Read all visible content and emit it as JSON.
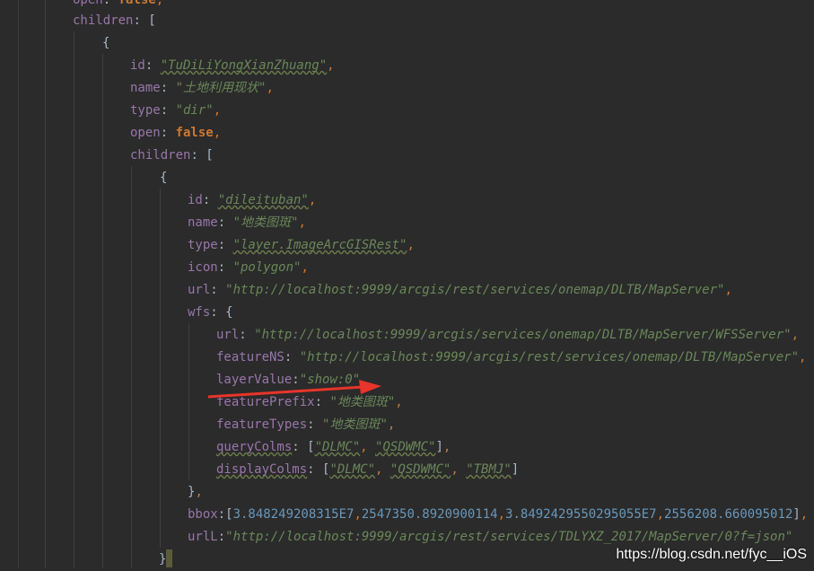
{
  "lines": [
    {
      "name": "line-open",
      "parts": [
        [
          "key",
          "open"
        ],
        [
          "plain",
          ": "
        ],
        [
          "kw",
          "false"
        ],
        [
          "punct",
          ","
        ]
      ]
    },
    {
      "name": "line-children-1",
      "parts": [
        [
          "key",
          "children"
        ],
        [
          "plain",
          ": ["
        ]
      ]
    },
    {
      "name": "line-brace-1",
      "parts": [
        [
          "plain",
          "{"
        ]
      ]
    },
    {
      "name": "line-id-1",
      "parts": [
        [
          "key",
          "id"
        ],
        [
          "plain",
          ": "
        ],
        [
          "str",
          "\"TuDiLiYongXianZhuang\""
        ],
        [
          "punct",
          ","
        ]
      ]
    },
    {
      "name": "line-name-1",
      "parts": [
        [
          "key",
          "name"
        ],
        [
          "plain",
          ": "
        ],
        [
          "str",
          "\"土地利用现状\""
        ],
        [
          "punct",
          ","
        ]
      ]
    },
    {
      "name": "line-type-1",
      "parts": [
        [
          "key",
          "type"
        ],
        [
          "plain",
          ": "
        ],
        [
          "str",
          "\"dir\""
        ],
        [
          "punct",
          ","
        ]
      ]
    },
    {
      "name": "line-open-2",
      "parts": [
        [
          "key",
          "open"
        ],
        [
          "plain",
          ": "
        ],
        [
          "kw",
          "false"
        ],
        [
          "punct",
          ","
        ]
      ]
    },
    {
      "name": "line-children-2",
      "parts": [
        [
          "key",
          "children"
        ],
        [
          "plain",
          ": ["
        ]
      ]
    },
    {
      "name": "line-brace-2",
      "parts": [
        [
          "plain",
          "{"
        ]
      ]
    },
    {
      "name": "line-id-2",
      "parts": [
        [
          "key",
          "id"
        ],
        [
          "plain",
          ": "
        ],
        [
          "str",
          "\"dileituban\""
        ],
        [
          "punct",
          ","
        ]
      ]
    },
    {
      "name": "line-name-2",
      "parts": [
        [
          "key",
          "name"
        ],
        [
          "plain",
          ": "
        ],
        [
          "str",
          "\"地类图斑\""
        ],
        [
          "punct",
          ","
        ]
      ]
    },
    {
      "name": "line-type-2",
      "parts": [
        [
          "key",
          "type"
        ],
        [
          "plain",
          ": "
        ],
        [
          "str",
          "\"layer.ImageArcGISRest\""
        ],
        [
          "punct",
          ","
        ]
      ]
    },
    {
      "name": "line-icon",
      "parts": [
        [
          "key",
          "icon"
        ],
        [
          "plain",
          ": "
        ],
        [
          "str",
          "\"polygon\""
        ],
        [
          "punct",
          ","
        ]
      ]
    },
    {
      "name": "line-url",
      "parts": [
        [
          "key",
          "url"
        ],
        [
          "plain",
          ": "
        ],
        [
          "str",
          "\"http://localhost:9999/arcgis/rest/services/onemap/DLTB/MapServer\""
        ],
        [
          "punct",
          ","
        ]
      ]
    },
    {
      "name": "line-wfs",
      "parts": [
        [
          "key",
          "wfs"
        ],
        [
          "plain",
          ": {"
        ]
      ]
    },
    {
      "name": "line-wfs-url",
      "parts": [
        [
          "key",
          "url"
        ],
        [
          "plain",
          ": "
        ],
        [
          "str",
          "\"http://localhost:9999/arcgis/services/onemap/DLTB/MapServer/WFSServer\""
        ],
        [
          "punct",
          ","
        ]
      ]
    },
    {
      "name": "line-featurens",
      "parts": [
        [
          "key",
          "featureNS"
        ],
        [
          "plain",
          ": "
        ],
        [
          "str",
          "\"http://localhost:9999/arcgis/rest/services/onemap/DLTB/MapServer\""
        ],
        [
          "punct",
          ","
        ]
      ]
    },
    {
      "name": "line-layervalue",
      "parts": [
        [
          "key",
          "layerValue"
        ],
        [
          "plain",
          ":"
        ],
        [
          "str",
          "\"show:0\""
        ],
        [
          "punct",
          ","
        ]
      ]
    },
    {
      "name": "line-featureprefix",
      "parts": [
        [
          "key",
          "featurePrefix"
        ],
        [
          "plain",
          ": "
        ],
        [
          "str",
          "\"地类图斑\""
        ],
        [
          "punct",
          ","
        ]
      ]
    },
    {
      "name": "line-featuretypes",
      "parts": [
        [
          "key",
          "featureTypes"
        ],
        [
          "plain",
          ": "
        ],
        [
          "str",
          "\"地类图斑\""
        ],
        [
          "punct",
          ","
        ]
      ]
    },
    {
      "name": "line-querycolms",
      "parts": [
        [
          "key",
          "queryColms"
        ],
        [
          "plain",
          ": ["
        ],
        [
          "str",
          "\"DLMC\""
        ],
        [
          "punct",
          ", "
        ],
        [
          "str",
          "\"QSDWMC\""
        ],
        [
          "plain",
          "]"
        ],
        [
          "punct",
          ","
        ]
      ]
    },
    {
      "name": "line-displaycolms",
      "parts": [
        [
          "key",
          "displayColms"
        ],
        [
          "plain",
          ": ["
        ],
        [
          "str",
          "\"DLMC\""
        ],
        [
          "punct",
          ", "
        ],
        [
          "str",
          "\"QSDWMC\""
        ],
        [
          "punct",
          ", "
        ],
        [
          "str",
          "\"TBMJ\""
        ],
        [
          "plain",
          "]"
        ]
      ]
    },
    {
      "name": "line-close-wfs",
      "parts": [
        [
          "plain",
          "}"
        ],
        [
          "punct",
          ","
        ]
      ]
    },
    {
      "name": "line-bbox",
      "parts": [
        [
          "key",
          "bbox"
        ],
        [
          "plain",
          ":["
        ],
        [
          "num",
          "3.848249208315E7"
        ],
        [
          "punct",
          ","
        ],
        [
          "num",
          "2547350.8920900114"
        ],
        [
          "punct",
          ","
        ],
        [
          "num",
          "3.8492429550295055E7"
        ],
        [
          "punct",
          ","
        ],
        [
          "num",
          "2556208.660095012"
        ],
        [
          "plain",
          "]"
        ],
        [
          "punct",
          ","
        ]
      ]
    },
    {
      "name": "line-urll",
      "parts": [
        [
          "key",
          "urlL"
        ],
        [
          "plain",
          ":"
        ],
        [
          "str",
          "\"http://localhost:9999/arcgis/rest/services/TDLYXZ_2017/MapServer/0?f=json\""
        ]
      ]
    },
    {
      "name": "line-close-brace-2",
      "parts": [
        [
          "plain",
          "}"
        ],
        [
          "punct",
          ","
        ]
      ]
    }
  ],
  "watermark": "https://blog.csdn.net/fyc__iOS",
  "colors": {
    "background": "#2b2b2b",
    "key": "#9876aa",
    "string": "#6a8759",
    "keyword": "#cc7832",
    "number": "#6897bb",
    "arrow": "#e8342a"
  }
}
